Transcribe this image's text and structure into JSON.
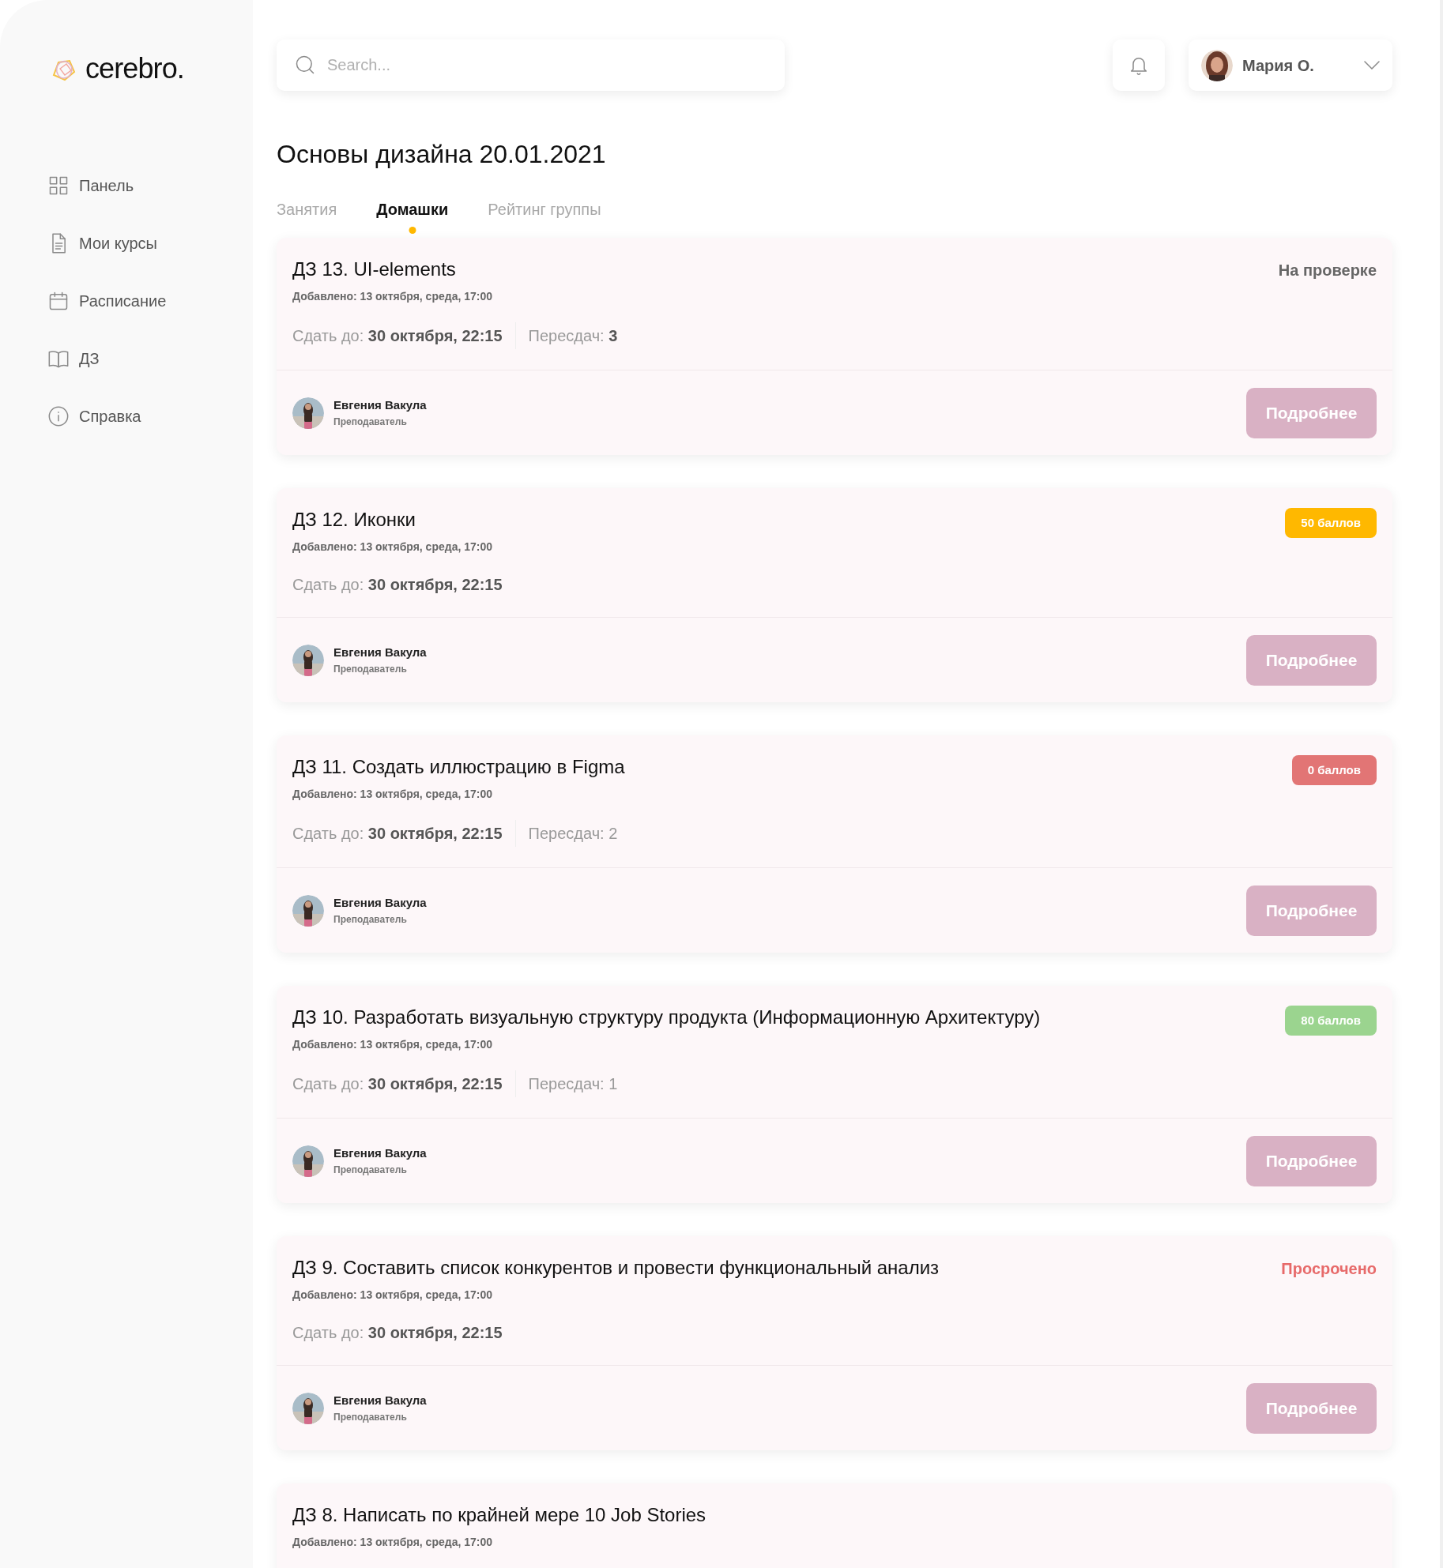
{
  "logo": {
    "text": "cerebro."
  },
  "sidebar": {
    "items": [
      {
        "label": "Панель",
        "kind": "grid"
      },
      {
        "label": "Мои курсы",
        "kind": "document"
      },
      {
        "label": "Расписание",
        "kind": "calendar"
      },
      {
        "label": "ДЗ",
        "kind": "book"
      },
      {
        "label": "Справка",
        "kind": "info"
      }
    ]
  },
  "search": {
    "placeholder": "Search..."
  },
  "user": {
    "name": "Мария О."
  },
  "page_title": "Основы дизайна 20.01.2021",
  "tabs": [
    {
      "label": "Занятия",
      "selected": false
    },
    {
      "label": "Домашки",
      "selected": true
    },
    {
      "label": "Рейтинг группы",
      "selected": false
    }
  ],
  "assignments": [
    {
      "title": "ДЗ 13. UI-elements",
      "added": "Добавлено: 13 октября, среда, 17:00",
      "deadline": "Сдать до: **30 октября, 22:15**",
      "resubmits": "Пересдач: **3**",
      "status": {
        "kind": "review",
        "label": "На проверке"
      },
      "teacher": {
        "name": "Евгения Вакула",
        "role": "Преподаватель"
      },
      "button": "Подробнее"
    },
    {
      "title": "ДЗ 12. Иконки",
      "added": "Добавлено: 13 октября, среда, 17:00",
      "deadline": "Сдать до: **30 октября, 22:15**",
      "status": {
        "kind": "badge",
        "label": "50 баллов",
        "color": "#ffb800"
      },
      "teacher": {
        "name": "Евгения Вакула",
        "role": "Преподаватель"
      },
      "button": "Подробнее"
    },
    {
      "title": "ДЗ 11. Создать иллюстрацию в Figma",
      "added": "Добавлено: 13 октября, среда, 17:00",
      "deadline": "Сдать до: **30 октября, 22:15**",
      "resubmits": "Пересдач: 2",
      "status": {
        "kind": "badge",
        "label": "0 баллов",
        "color": "#e27575"
      },
      "teacher": {
        "name": "Евгения Вакула",
        "role": "Преподаватель"
      },
      "button": "Подробнее"
    },
    {
      "title": "ДЗ 10. Разработать визуальную структуру продукта (Информационную Архитектуру)",
      "added": "Добавлено: 13 октября, среда, 17:00",
      "deadline": "Сдать до: **30 октября, 22:15**",
      "resubmits": "Пересдач: 1",
      "status": {
        "kind": "badge",
        "label": "80 баллов",
        "color": "#9bd48f"
      },
      "teacher": {
        "name": "Евгения Вакула",
        "role": "Преподаватель"
      },
      "button": "Подробнее"
    },
    {
      "title": "ДЗ 9. Составить список конкурентов и провести функциональный анализ",
      "added": "Добавлено: 13 октября, среда, 17:00",
      "deadline": "Сдать до: **30 октября, 22:15**",
      "status": {
        "kind": "overdue",
        "label": "Просрочено"
      },
      "teacher": {
        "name": "Евгения Вакула",
        "role": "Преподаватель"
      },
      "button": "Подробнее"
    },
    {
      "title": "ДЗ 8. Написать по крайней мере 10 Job Stories",
      "added": "Добавлено: 13 октября, среда, 17:00"
    }
  ]
}
